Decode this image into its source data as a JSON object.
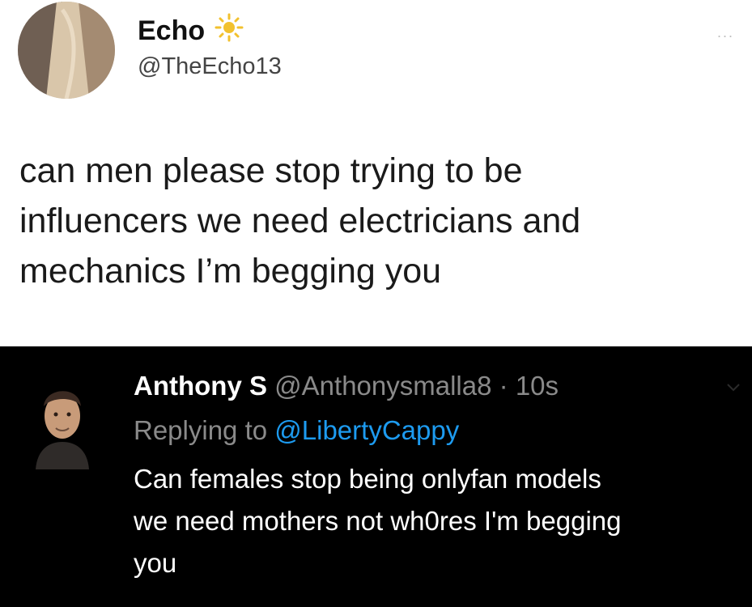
{
  "tweet": {
    "name": "Echo",
    "handle": "@TheEcho13",
    "text": "can men please stop trying to be\ninfluencers we need electricians and\nmechanics I’m begging you",
    "more": "..."
  },
  "reply": {
    "name": "Anthony S",
    "handle": "@Anthonysmalla8",
    "sep": "·",
    "time": "10s",
    "replying_prefix": "Replying to ",
    "replying_handle": "@LibertyCappy",
    "text": "Can females stop being onlyfan models\nwe need mothers not wh0res I'm begging\nyou"
  },
  "colors": {
    "link": "#1d9bf0",
    "sun": "#f2c12e"
  },
  "icons": {
    "badge": "sun-icon",
    "menu": "more-icon",
    "chevron": "chevron-down-icon"
  }
}
